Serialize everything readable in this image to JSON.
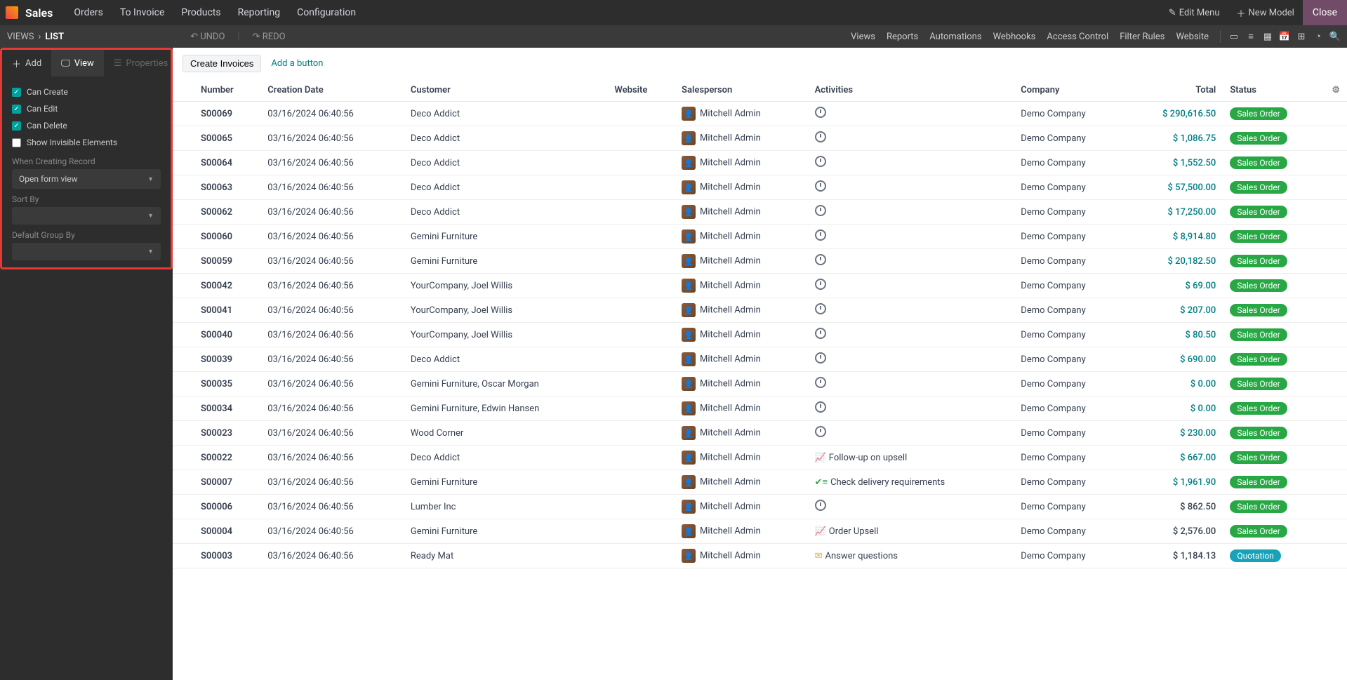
{
  "navbar": {
    "app_name": "Sales",
    "menu": [
      "Orders",
      "To Invoice",
      "Products",
      "Reporting",
      "Configuration"
    ],
    "edit_menu": "Edit Menu",
    "new_model": "New Model",
    "close": "Close"
  },
  "subnav": {
    "breadcrumb": [
      "VIEWS",
      "LIST"
    ],
    "undo": "UNDO",
    "redo": "REDO",
    "links": [
      "Views",
      "Reports",
      "Automations",
      "Webhooks",
      "Access Control",
      "Filter Rules",
      "Website"
    ]
  },
  "sidebar": {
    "tabs": {
      "add": "Add",
      "view": "View",
      "properties": "Properties"
    },
    "can_create": "Can Create",
    "can_edit": "Can Edit",
    "can_delete": "Can Delete",
    "show_invisible": "Show Invisible Elements",
    "when_creating_label": "When Creating Record",
    "when_creating_value": "Open form view",
    "sort_by_label": "Sort By",
    "sort_by_value": "",
    "group_by_label": "Default Group By",
    "group_by_value": ""
  },
  "toolbar": {
    "create_invoices": "Create Invoices",
    "add_button": "Add a button"
  },
  "columns": {
    "number": "Number",
    "creation_date": "Creation Date",
    "customer": "Customer",
    "website": "Website",
    "salesperson": "Salesperson",
    "activities": "Activities",
    "company": "Company",
    "total": "Total",
    "status": "Status"
  },
  "status_labels": {
    "sales_order": "Sales Order",
    "quotation": "Quotation"
  },
  "rows": [
    {
      "number": "S00069",
      "date": "03/16/2024 06:40:56",
      "customer": "Deco Addict",
      "salesperson": "Mitchell Admin",
      "activity": {
        "type": "clock"
      },
      "company": "Demo Company",
      "total": "$ 290,616.50",
      "total_link": true,
      "status": "sales_order"
    },
    {
      "number": "S00065",
      "date": "03/16/2024 06:40:56",
      "customer": "Deco Addict",
      "salesperson": "Mitchell Admin",
      "activity": {
        "type": "clock"
      },
      "company": "Demo Company",
      "total": "$ 1,086.75",
      "total_link": true,
      "status": "sales_order"
    },
    {
      "number": "S00064",
      "date": "03/16/2024 06:40:56",
      "customer": "Deco Addict",
      "salesperson": "Mitchell Admin",
      "activity": {
        "type": "clock"
      },
      "company": "Demo Company",
      "total": "$ 1,552.50",
      "total_link": true,
      "status": "sales_order"
    },
    {
      "number": "S00063",
      "date": "03/16/2024 06:40:56",
      "customer": "Deco Addict",
      "salesperson": "Mitchell Admin",
      "activity": {
        "type": "clock"
      },
      "company": "Demo Company",
      "total": "$ 57,500.00",
      "total_link": true,
      "status": "sales_order"
    },
    {
      "number": "S00062",
      "date": "03/16/2024 06:40:56",
      "customer": "Deco Addict",
      "salesperson": "Mitchell Admin",
      "activity": {
        "type": "clock"
      },
      "company": "Demo Company",
      "total": "$ 17,250.00",
      "total_link": true,
      "status": "sales_order"
    },
    {
      "number": "S00060",
      "date": "03/16/2024 06:40:56",
      "customer": "Gemini Furniture",
      "salesperson": "Mitchell Admin",
      "activity": {
        "type": "clock"
      },
      "company": "Demo Company",
      "total": "$ 8,914.80",
      "total_link": true,
      "status": "sales_order"
    },
    {
      "number": "S00059",
      "date": "03/16/2024 06:40:56",
      "customer": "Gemini Furniture",
      "salesperson": "Mitchell Admin",
      "activity": {
        "type": "clock"
      },
      "company": "Demo Company",
      "total": "$ 20,182.50",
      "total_link": true,
      "status": "sales_order"
    },
    {
      "number": "S00042",
      "date": "03/16/2024 06:40:56",
      "customer": "YourCompany, Joel Willis",
      "salesperson": "Mitchell Admin",
      "activity": {
        "type": "clock"
      },
      "company": "Demo Company",
      "total": "$ 69.00",
      "total_link": true,
      "status": "sales_order"
    },
    {
      "number": "S00041",
      "date": "03/16/2024 06:40:56",
      "customer": "YourCompany, Joel Willis",
      "salesperson": "Mitchell Admin",
      "activity": {
        "type": "clock"
      },
      "company": "Demo Company",
      "total": "$ 207.00",
      "total_link": true,
      "status": "sales_order"
    },
    {
      "number": "S00040",
      "date": "03/16/2024 06:40:56",
      "customer": "YourCompany, Joel Willis",
      "salesperson": "Mitchell Admin",
      "activity": {
        "type": "clock"
      },
      "company": "Demo Company",
      "total": "$ 80.50",
      "total_link": true,
      "status": "sales_order"
    },
    {
      "number": "S00039",
      "date": "03/16/2024 06:40:56",
      "customer": "Deco Addict",
      "salesperson": "Mitchell Admin",
      "activity": {
        "type": "clock"
      },
      "company": "Demo Company",
      "total": "$ 690.00",
      "total_link": true,
      "status": "sales_order"
    },
    {
      "number": "S00035",
      "date": "03/16/2024 06:40:56",
      "customer": "Gemini Furniture, Oscar Morgan",
      "salesperson": "Mitchell Admin",
      "activity": {
        "type": "clock"
      },
      "company": "Demo Company",
      "total": "$ 0.00",
      "total_link": true,
      "status": "sales_order"
    },
    {
      "number": "S00034",
      "date": "03/16/2024 06:40:56",
      "customer": "Gemini Furniture, Edwin Hansen",
      "salesperson": "Mitchell Admin",
      "activity": {
        "type": "clock"
      },
      "company": "Demo Company",
      "total": "$ 0.00",
      "total_link": true,
      "status": "sales_order"
    },
    {
      "number": "S00023",
      "date": "03/16/2024 06:40:56",
      "customer": "Wood Corner",
      "salesperson": "Mitchell Admin",
      "activity": {
        "type": "clock"
      },
      "company": "Demo Company",
      "total": "$ 230.00",
      "total_link": true,
      "status": "sales_order"
    },
    {
      "number": "S00022",
      "date": "03/16/2024 06:40:56",
      "customer": "Deco Addict",
      "salesperson": "Mitchell Admin",
      "activity": {
        "type": "chart",
        "text": "Follow-up on upsell"
      },
      "company": "Demo Company",
      "total": "$ 667.00",
      "total_link": true,
      "status": "sales_order"
    },
    {
      "number": "S00007",
      "date": "03/16/2024 06:40:56",
      "customer": "Gemini Furniture",
      "salesperson": "Mitchell Admin",
      "activity": {
        "type": "check",
        "text": "Check delivery requirements"
      },
      "company": "Demo Company",
      "total": "$ 1,961.90",
      "total_link": true,
      "status": "sales_order"
    },
    {
      "number": "S00006",
      "date": "03/16/2024 06:40:56",
      "customer": "Lumber Inc",
      "salesperson": "Mitchell Admin",
      "activity": {
        "type": "clock"
      },
      "company": "Demo Company",
      "total": "$ 862.50",
      "total_link": false,
      "status": "sales_order"
    },
    {
      "number": "S00004",
      "date": "03/16/2024 06:40:56",
      "customer": "Gemini Furniture",
      "salesperson": "Mitchell Admin",
      "activity": {
        "type": "chart",
        "text": "Order Upsell"
      },
      "company": "Demo Company",
      "total": "$ 2,576.00",
      "total_link": false,
      "status": "sales_order"
    },
    {
      "number": "S00003",
      "date": "03/16/2024 06:40:56",
      "customer": "Ready Mat",
      "salesperson": "Mitchell Admin",
      "activity": {
        "type": "mail",
        "text": "Answer questions"
      },
      "company": "Demo Company",
      "total": "$ 1,184.13",
      "total_link": false,
      "status": "quotation"
    }
  ]
}
